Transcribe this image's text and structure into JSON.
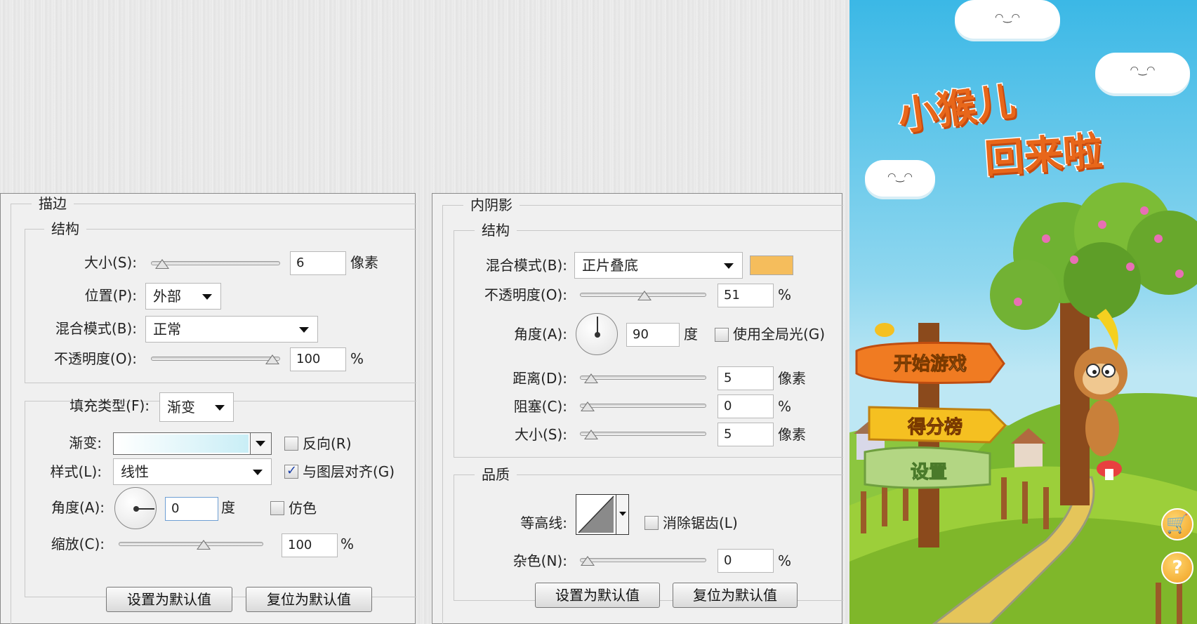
{
  "stroke_panel": {
    "title": "描边",
    "structure": {
      "legend": "结构",
      "size_label": "大小(S):",
      "size_value": "6",
      "size_unit": "像素",
      "size_level": 0.03,
      "position_label": "位置(P):",
      "position_value": "外部",
      "blend_label": "混合模式(B):",
      "blend_value": "正常",
      "opacity_label": "不透明度(O):",
      "opacity_value": "100",
      "opacity_unit": "%",
      "opacity_level": 1.0
    },
    "fill": {
      "fill_type_label": "填充类型(F):",
      "fill_type_value": "渐变",
      "gradient_label": "渐变:",
      "reverse_label": "反向(R)",
      "reverse_checked": false,
      "style_label": "样式(L):",
      "style_value": "线性",
      "align_label": "与图层对齐(G)",
      "align_checked": true,
      "angle_label": "角度(A):",
      "angle_value": "0",
      "angle_unit": "度",
      "dither_label": "仿色",
      "dither_checked": false,
      "scale_label": "缩放(C):",
      "scale_value": "100",
      "scale_unit": "%",
      "scale_level": 0.6
    },
    "buttons": {
      "set_default": "设置为默认值",
      "reset_default": "复位为默认值"
    }
  },
  "inner_shadow_panel": {
    "title": "内阴影",
    "structure": {
      "legend": "结构",
      "blend_label": "混合模式(B):",
      "blend_value": "正片叠底",
      "color": "#f5bd5c",
      "opacity_label": "不透明度(O):",
      "opacity_value": "51",
      "opacity_unit": "%",
      "opacity_level": 0.51,
      "angle_label": "角度(A):",
      "angle_value": "90",
      "angle_unit": "度",
      "global_light_label": "使用全局光(G)",
      "global_light_checked": false,
      "distance_label": "距离(D):",
      "distance_value": "5",
      "distance_unit": "像素",
      "distance_level": 0.03,
      "choke_label": "阻塞(C):",
      "choke_value": "0",
      "choke_unit": "%",
      "choke_level": 0.0,
      "size_label": "大小(S):",
      "size_value": "5",
      "size_unit": "像素",
      "size_level": 0.03
    },
    "quality": {
      "legend": "品质",
      "contour_label": "等高线:",
      "antialias_label": "消除锯齿(L)",
      "antialias_checked": false,
      "noise_label": "杂色(N):",
      "noise_value": "0",
      "noise_unit": "%",
      "noise_level": 0.0
    },
    "buttons": {
      "set_default": "设置为默认值",
      "reset_default": "复位为默认值"
    }
  },
  "game": {
    "title_line1": "小猴儿",
    "title_line2": "回来啦",
    "start_button": "开始游戏",
    "leaderboard_button": "得分榜",
    "settings_button": "设置",
    "cart_icon": "shopping-cart-icon",
    "help_icon": "help-icon"
  }
}
